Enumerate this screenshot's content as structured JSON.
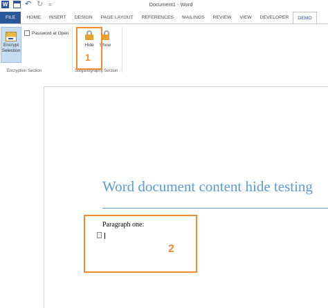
{
  "title_bar": {
    "document_title": "Document1 - Word",
    "qat_icons": [
      "word-icon",
      "save-icon",
      "undo-icon",
      "redo-icon",
      "customize-qat-icon"
    ],
    "qat_glyphs": {
      "word": "W",
      "undo": "↶",
      "redo": "↻",
      "more": "="
    }
  },
  "tabs": [
    "FILE",
    "HOME",
    "INSERT",
    "DESIGN",
    "PAGE LAYOUT",
    "REFERENCES",
    "MAILINGS",
    "REVIEW",
    "VIEW",
    "DEVELOPER",
    "DEMO"
  ],
  "active_tab": "DEMO",
  "ribbon": {
    "encrypt_label_line1": "Encrypt",
    "encrypt_label_line2": "Selection",
    "password_checkbox_label": "Password at Open",
    "encryption_group_label": "Encryption Section",
    "hide_label": "Hide",
    "show_label": "Show",
    "steganography_group_label": "Steganography Section"
  },
  "annotations": {
    "callout_1": "1",
    "callout_2": "2",
    "color": "#f28a30"
  },
  "document": {
    "heading": "Word document content hide testing",
    "paragraph": "Paragraph one:"
  },
  "colors": {
    "accent": "#2b579a",
    "heading": "#5b9bd5",
    "callout": "#f28a30"
  }
}
